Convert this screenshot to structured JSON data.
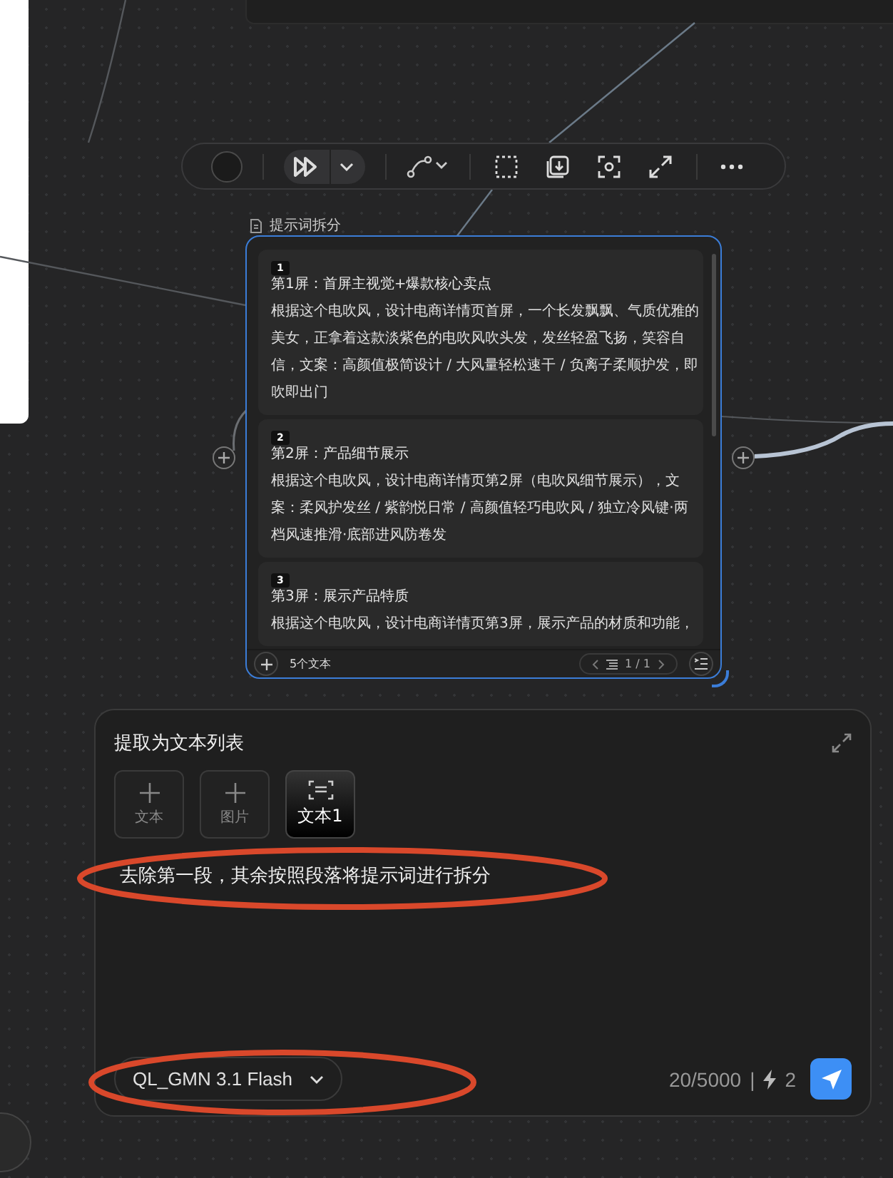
{
  "node": {
    "label": "提示词拆分",
    "items": [
      {
        "index": "1",
        "title": "第1屏：首屏主视觉+爆款核心卖点",
        "body": "根据这个电吹风，设计电商详情页首屏，一个长发飘飘、气质优雅的美女，正拿着这款淡紫色的电吹风吹头发，发丝轻盈飞扬，笑容自信，文案：高颜值极简设计 / 大风量轻松速干 / 负离子柔顺护发，即吹即出门"
      },
      {
        "index": "2",
        "title": "第2屏：产品细节展示",
        "body": "根据这个电吹风，设计电商详情页第2屏（电吹风细节展示），文案：柔风护发丝 / 紫韵悦日常 / 高颜值轻巧电吹风 / 独立冷风键·两档风速推滑·底部进风防卷发"
      },
      {
        "index": "3",
        "title": "第3屏：展示产品特质",
        "body": "根据这个电吹风，设计电商详情页第3屏，展示产品的材质和功能，"
      }
    ],
    "count": "5个文本",
    "pager": "1 / 1"
  },
  "panel": {
    "title": "提取为文本列表",
    "attachments": [
      {
        "kind": "add",
        "label": "文本"
      },
      {
        "kind": "add",
        "label": "图片"
      },
      {
        "kind": "file",
        "label": "文本1"
      }
    ],
    "prompt": "去除第一段，其余按照段落将提示词进行拆分",
    "model": "QL_GMN 3.1 Flash",
    "char_count": "20/5000",
    "separator": "|",
    "credits": "2"
  }
}
